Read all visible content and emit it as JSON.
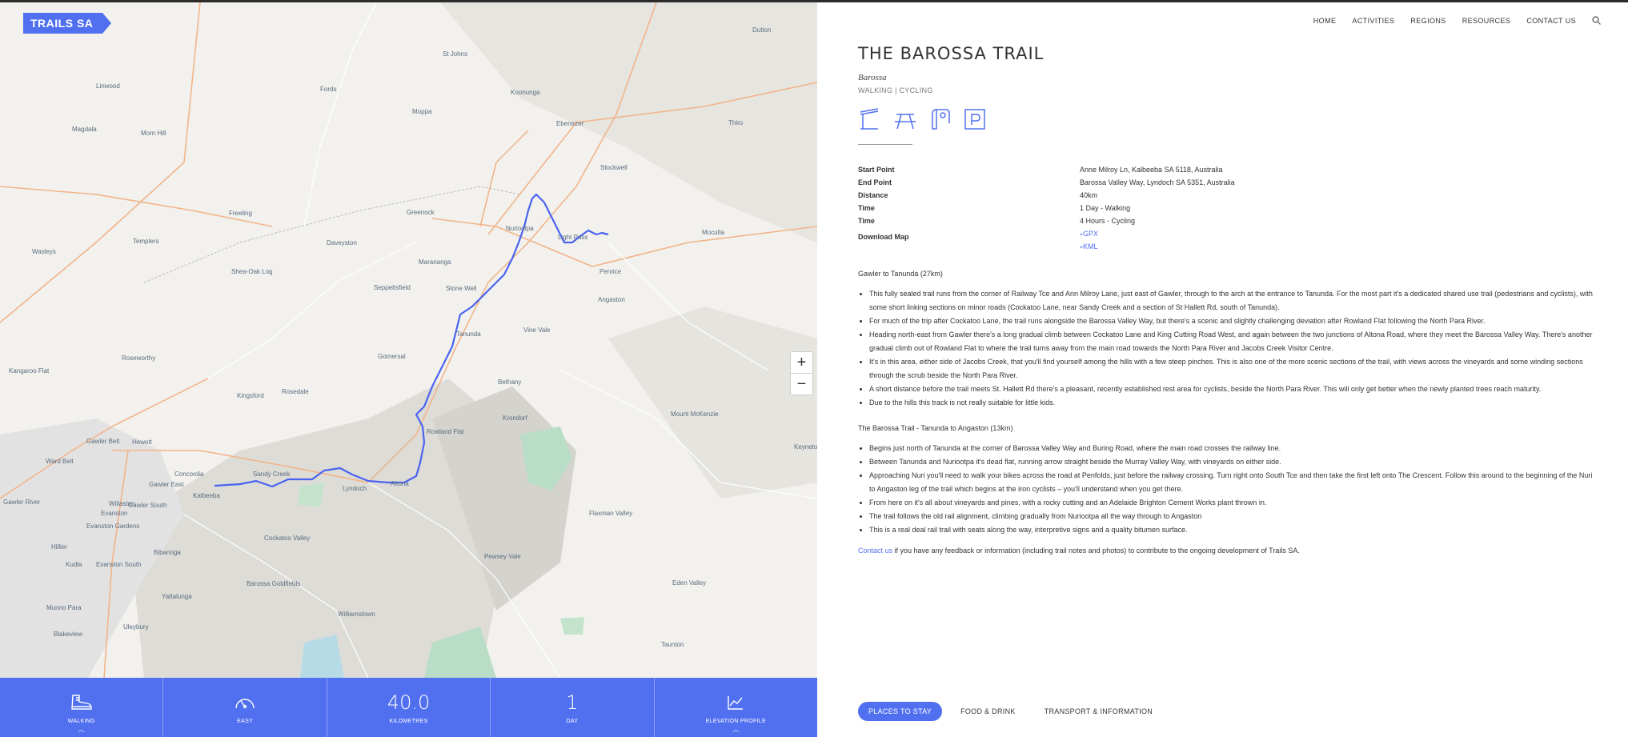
{
  "logo": "TRAILS SA",
  "nav": [
    "HOME",
    "ACTIVITIES",
    "REGIONS",
    "RESOURCES",
    "CONTACT US"
  ],
  "trail": {
    "title": "THE BAROSSA TRAIL",
    "region": "Barossa",
    "activities": "WALKING  |  CYCLING",
    "facilities": [
      "shelter-icon",
      "picnic-table-icon",
      "toilet-icon",
      "parking-icon"
    ]
  },
  "info": {
    "start_point_label": "Start Point",
    "start_point": "Anne Milroy Ln, Kalbeeba SA 5118, Australia",
    "end_point_label": "End Point",
    "end_point": "Barossa Valley Way, Lyndoch SA 5351, Australia",
    "distance_label": "Distance",
    "distance": "40km",
    "time_label": "Time",
    "time_walking": "1 Day - Walking",
    "time_cycling": "4 Hours - Cycling",
    "download_label": "Download Map",
    "gpx": "GPX",
    "kml": "KML"
  },
  "section1": {
    "title": "Gawler to Tanunda (27km)",
    "bullets": [
      "This fully sealed trail runs from the corner of Railway Tce and Ann Milroy Lane, just east of Gawler, through to the arch at the entrance to Tanunda. For the most part it's a dedicated shared use trail (pedestrians and cyclists), with some short linking sections on minor roads (Cockatoo Lane, near Sandy Creek and a section of St Hallett Rd, south of Tanunda).",
      "For much of the trip after Cockatoo Lane, the trail runs alongside the Barossa Valley Way, but there's a scenic and slightly challenging deviation after Rowland Flat following the North Para River.",
      "Heading north-east from Gawler there's a long gradual climb between Cockatoo Lane and King Cutting Road West, and again between the two junctions of Altona Road, where they meet the Barossa Valley Way. There's another gradual climb out of Rowland Flat to where the trail turns away from the main road towards the North Para River and Jacobs Creek Visitor Centre.",
      "It's in this area, either side of Jacobs Creek, that you'll find yourself among the hills with a few steep pinches. This is also one of the more scenic sections of the trail, with views across the vineyards and some winding sections through the scrub beside the North Para River.",
      "A short distance before the trail meets St. Hallett Rd there's a pleasant, recently established rest area for cyclists, beside the North Para River. This will only get better when the newly planted trees reach maturity.",
      "Due to the hills this track is not really suitable for little kids."
    ]
  },
  "section2": {
    "title": "The Barossa Trail - Tanunda to Angaston (13km)",
    "bullets": [
      "Begins just north of Tanunda at the corner of Barossa Valley Way and Buring Road, where the main road crosses the railway line.",
      "Between Tanunda and Nuriootpa it's dead flat, running arrow straight beside the Murray Valley Way, with vineyards on either side.",
      "Approaching Nuri you'll need to walk your bikes across the road at Penfolds, just before the railway crossing. Turn right onto South Tce and then take the first left onto The Crescent. Follow this around to the beginning of the Nuri to Angaston leg of the trail which begins at the iron cyclists – you'll understand when you get there.",
      "From here on it's all about vineyards and pines, with a rocky cutting and an Adelaide Brighton Cement Works plant thrown in.",
      "The trail follows the old rail alignment, climbing gradually from Nuriootpa all the way through to Angaston",
      "This is a real deal rail trail with seats along the way, interpretive signs and a quality bitumen surface."
    ]
  },
  "contact": {
    "link": "Contact us",
    "text": " if you have any feedback or information (including trail notes and photos) to contribute to the ongoing development of Trails SA."
  },
  "stats": {
    "walking": "WALKING",
    "difficulty": "EASY",
    "km_value": "40.0",
    "km_label": "KILOMETRES",
    "day_value": "1",
    "day_label": "DAY",
    "elevation": "ELEVATION PROFILE"
  },
  "tabs": [
    "PLACES TO STAY",
    "FOOD & DRINK",
    "TRANSPORT & INFORMATION"
  ],
  "map": {
    "places": [
      "Dutton",
      "Linwood",
      "St Johns",
      "Fords",
      "Koonunga",
      "Magdala",
      "Moppa",
      "Ebenezer",
      "Thiro",
      "Morn Hill",
      "Stockwell",
      "Freeling",
      "Greenock",
      "Nuriootpa",
      "Light Pass",
      "Moculta",
      "Templers",
      "Daveyston",
      "Wasleys",
      "Shea-Oak Log",
      "Marananga",
      "Penrice",
      "Seppeltsfield",
      "Stone Well",
      "Angaston",
      "Vine Vale",
      "Roseworthy",
      "Tanunda",
      "Kangaroo Flat",
      "Gomersal",
      "Bethany",
      "Rosedale",
      "Kingsford",
      "Krondorf",
      "Mount McKenzie",
      "Gawler Belt",
      "Hewett",
      "Rowland Flat",
      "Ward Belt",
      "Concordia",
      "Sandy Creek",
      "Gawler East",
      "Lyndoch",
      "Altona",
      "Gawler River",
      "Kalbeeba",
      "Willaston",
      "Gawler South",
      "Evanston",
      "Evanston Gardens",
      "Flaxman Valley",
      "Hillier",
      "Cockatoo Valley",
      "Kudla",
      "Evanston South",
      "Bibaringa",
      "Yattalunga",
      "Barossa Goldfields",
      "Pewsey Vale",
      "Eden Valley",
      "Munno Para",
      "Williamstown",
      "Uleybury",
      "Blakeview",
      "Taunton",
      "Keyneton"
    ],
    "zoom_in": "+",
    "zoom_out": "−"
  },
  "colors": {
    "accent": "#5170f0",
    "route": "#4a63f0",
    "map_bg": "#f1f0ec",
    "roads": "#f2b48a"
  }
}
